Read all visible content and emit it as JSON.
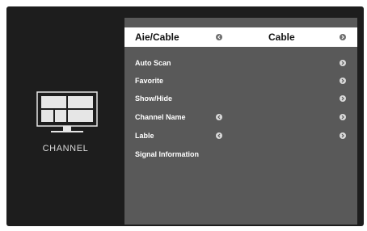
{
  "sidebar": {
    "caption": "CHANNEL",
    "icon": "tv-channel-icon"
  },
  "menu": {
    "selected": {
      "label": "Aie/Cable",
      "value": "Cable"
    },
    "items": [
      {
        "label": "Auto Scan"
      },
      {
        "label": "Favorite"
      },
      {
        "label": "Show/Hide"
      },
      {
        "label": "Channel Name"
      },
      {
        "label": "Lable"
      },
      {
        "label": "Signal Information"
      }
    ]
  },
  "colors": {
    "background": "#1d1d1d",
    "panel": "#595959",
    "selected_row": "#ffffff"
  }
}
